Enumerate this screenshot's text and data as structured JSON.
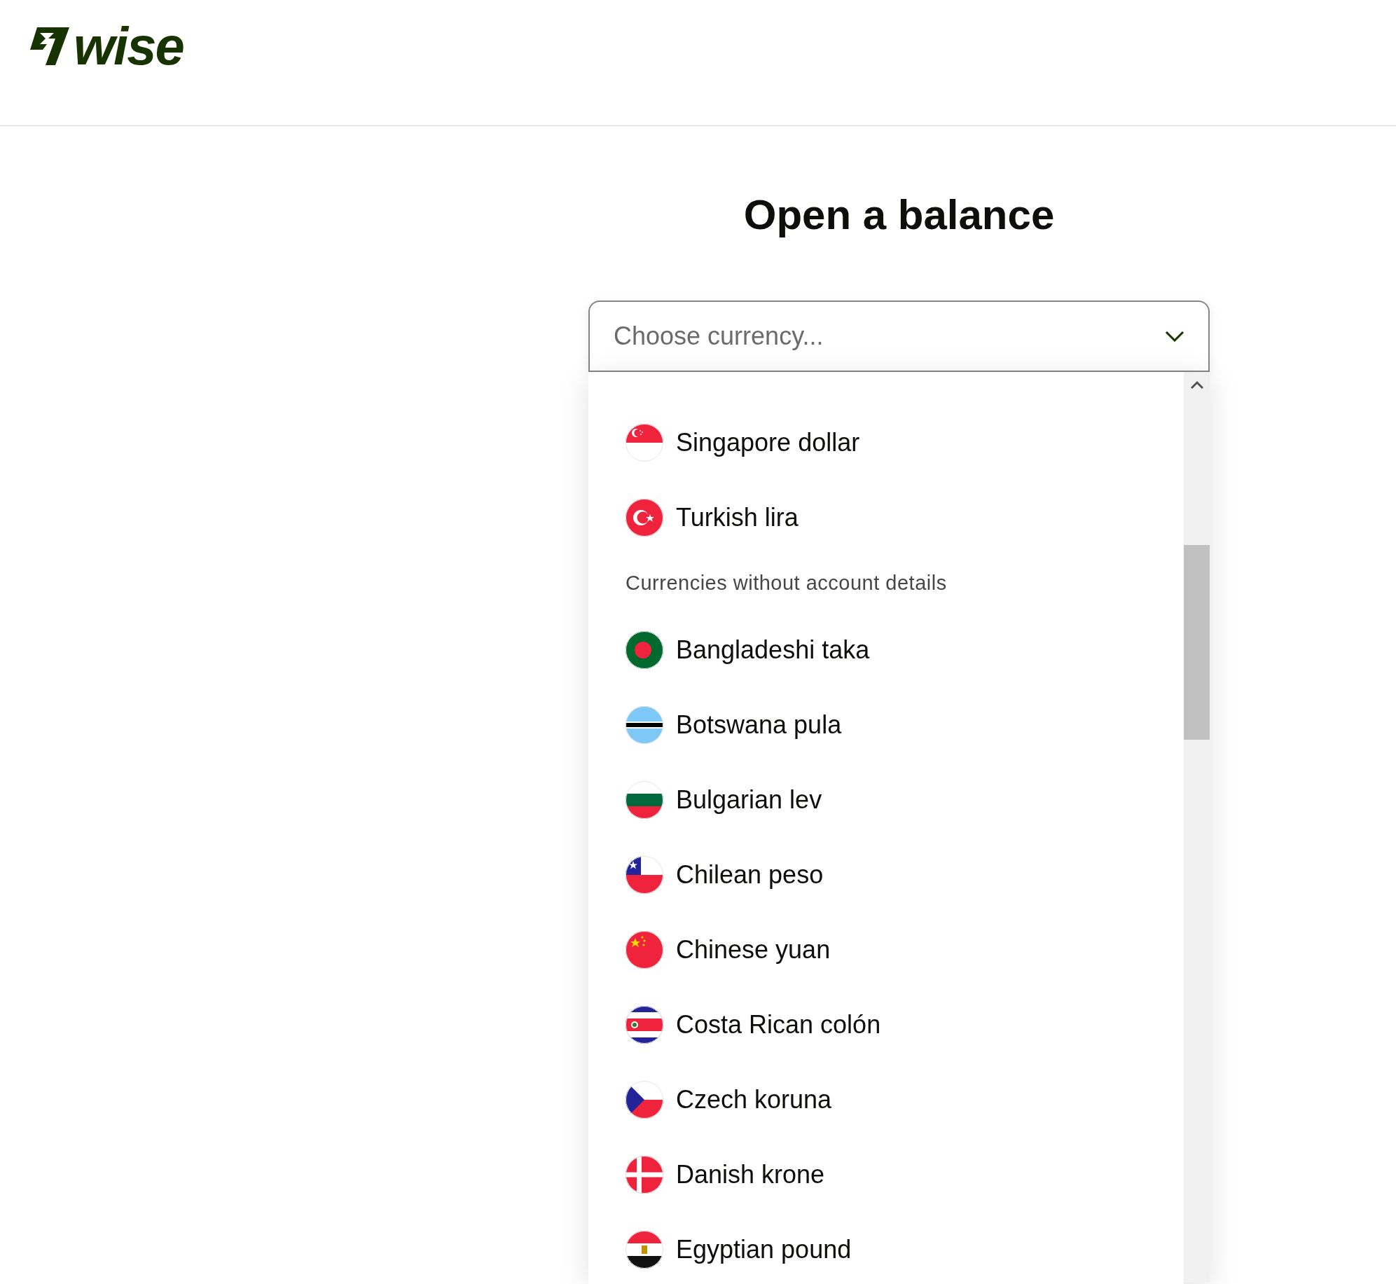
{
  "header": {
    "logo": {
      "text": "wise"
    }
  },
  "title": "Open a balance",
  "currency_select": {
    "placeholder": "Choose currency...",
    "expanded": true
  },
  "options": [
    {
      "kind": "currency",
      "label": "Singapore dollar"
    },
    {
      "kind": "currency",
      "label": "Turkish lira"
    },
    {
      "kind": "group_header",
      "label": "Currencies without account details"
    },
    {
      "kind": "currency",
      "label": "Bangladeshi taka"
    },
    {
      "kind": "currency",
      "label": "Botswana pula"
    },
    {
      "kind": "currency",
      "label": "Bulgarian lev"
    },
    {
      "kind": "currency",
      "label": "Chilean peso"
    },
    {
      "kind": "currency",
      "label": "Chinese yuan"
    },
    {
      "kind": "currency",
      "label": "Costa Rican colón"
    },
    {
      "kind": "currency",
      "label": "Czech koruna"
    },
    {
      "kind": "currency",
      "label": "Danish krone"
    },
    {
      "kind": "currency",
      "label": "Egyptian pound"
    }
  ]
}
